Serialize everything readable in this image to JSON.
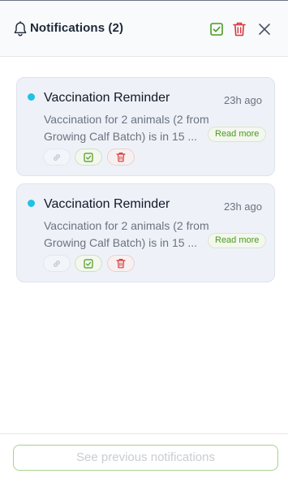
{
  "header": {
    "title": "Notifications (2)",
    "icons": {
      "bell": "bell-icon",
      "mark_all_read": "check-square-icon",
      "delete_all": "trash-icon",
      "close": "close-icon"
    }
  },
  "notifications": [
    {
      "title": "Vaccination Reminder",
      "time": "23h ago",
      "body_line1": "Vaccination for 2 animals (2 from",
      "body_line2": "Growing Calf Batch) is in 15 ...",
      "read_more": "Read more",
      "unread": true
    },
    {
      "title": "Vaccination Reminder",
      "time": "23h ago",
      "body_line1": "Vaccination for 2 animals (2 from",
      "body_line2": "Growing Calf Batch) is in 15 ...",
      "read_more": "Read more",
      "unread": true
    }
  ],
  "footer": {
    "previous_label": "See previous notifications"
  },
  "colors": {
    "accent_green": "#4a9a1f",
    "danger_red": "#d9383a",
    "unread_dot": "#22c1e6"
  }
}
